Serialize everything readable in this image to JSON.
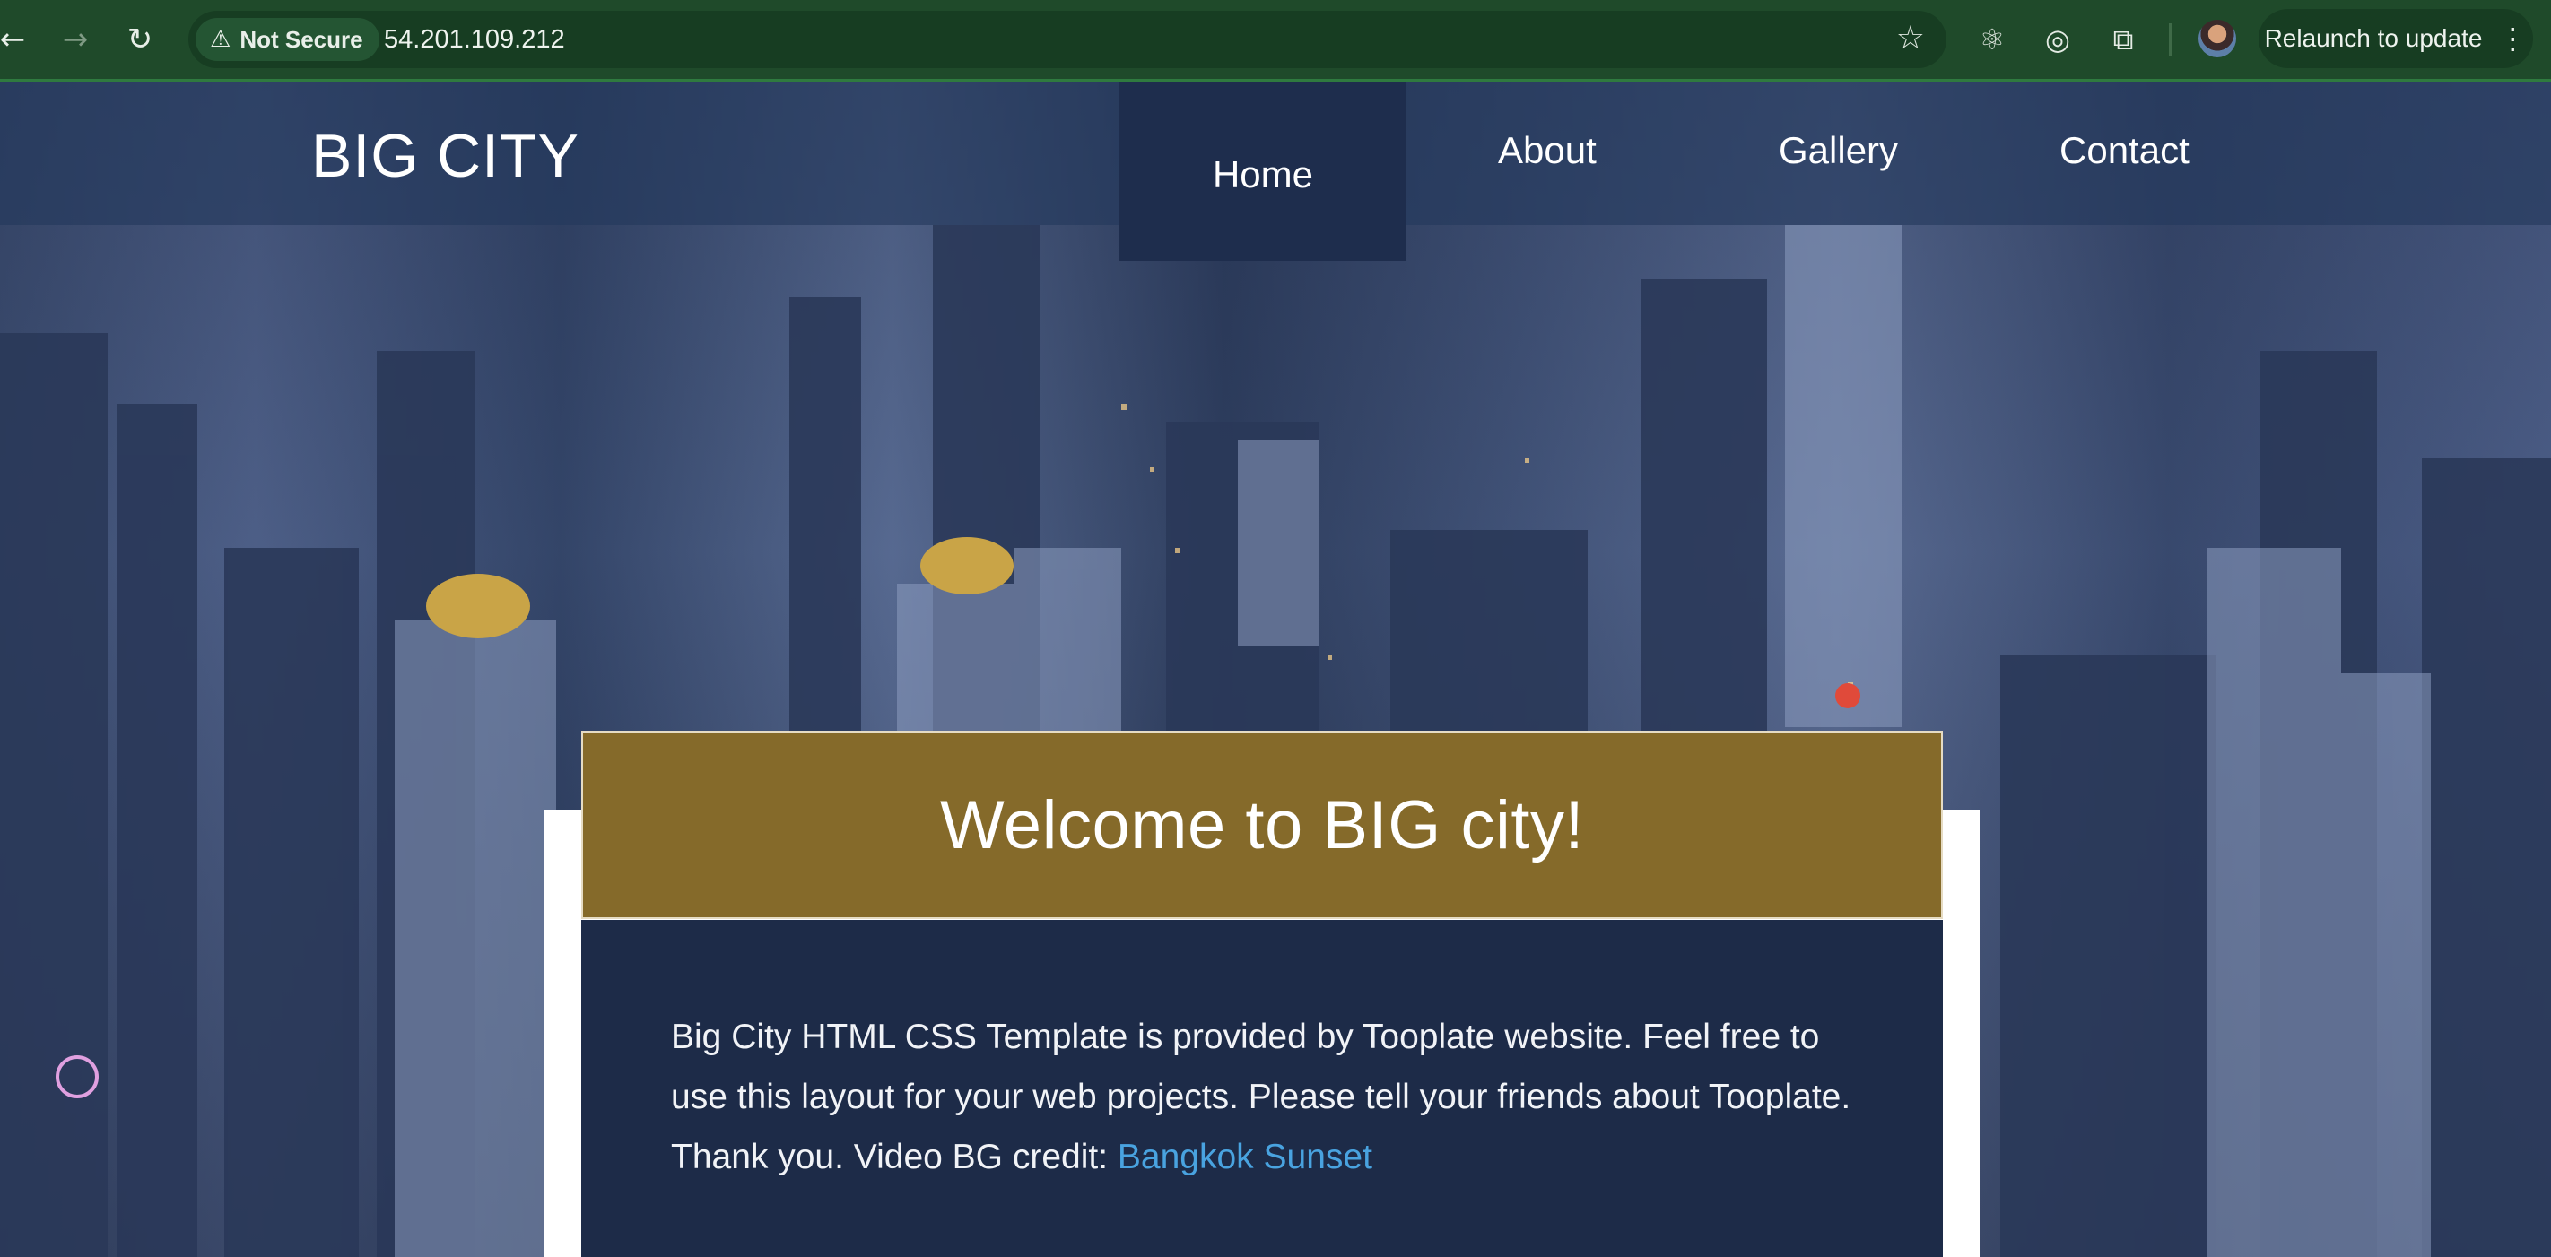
{
  "browser": {
    "security_label": "Not Secure",
    "url": "54.201.109.212",
    "relaunch_label": "Relaunch to update"
  },
  "site": {
    "brand": "BIG CITY",
    "nav": [
      "Home",
      "About",
      "Gallery",
      "Contact"
    ],
    "active_nav": "Home",
    "welcome_title": "Welcome to BIG city!",
    "intro_text": "Big City HTML CSS Template is provided by Tooplate website. Feel free to use this layout for your web projects. Please tell your friends about Tooplate. Thank you. Video BG credit:",
    "credit_link": "Bangkok Sunset"
  },
  "colors": {
    "chrome": "#1f4a2a",
    "title_box": "#856a2a",
    "content_panel": "#1d2b48",
    "link": "#49a3e0"
  },
  "icons": [
    "back-arrow-icon",
    "forward-arrow-icon",
    "reload-icon",
    "warning-icon",
    "star-icon",
    "react-extension-icon",
    "target-extension-icon",
    "puzzle-extension-icon",
    "kebab-menu-icon"
  ]
}
